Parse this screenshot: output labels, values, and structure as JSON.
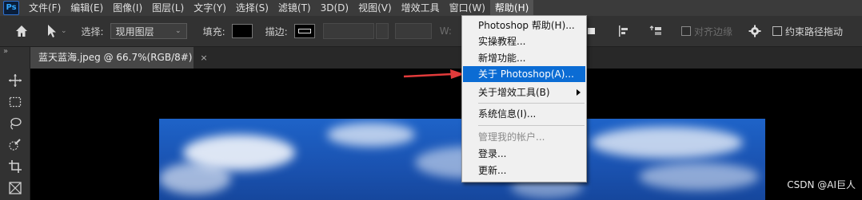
{
  "app": {
    "logo_text": "Ps"
  },
  "menubar": {
    "items": [
      "文件(F)",
      "编辑(E)",
      "图像(I)",
      "图层(L)",
      "文字(Y)",
      "选择(S)",
      "滤镜(T)",
      "3D(D)",
      "视图(V)",
      "增效工具",
      "窗口(W)",
      "帮助(H)"
    ],
    "active_index": 11
  },
  "options": {
    "select_label": "选择:",
    "select_value": "现用图层",
    "fill_label": "填充:",
    "stroke_label": "描边:",
    "w_label": "W:",
    "align_edges_label": "对齐边缘",
    "constrain_label": "约束路径拖动"
  },
  "document_tab": {
    "title": "蓝天蓝海.jpeg @ 66.7%(RGB/8#)",
    "close": "×"
  },
  "toolbar": {
    "collapse_glyph": "»"
  },
  "help_menu": {
    "items": [
      {
        "label": "Photoshop 帮助(H)...",
        "state": "normal"
      },
      {
        "label": "实操教程...",
        "state": "normal"
      },
      {
        "label": "新增功能...",
        "state": "normal"
      },
      {
        "label": "关于 Photoshop(A)...",
        "state": "highlighted"
      },
      {
        "label": "关于增效工具(B)",
        "state": "submenu"
      },
      {
        "label": "系统信息(I)...",
        "state": "normal"
      },
      {
        "label": "管理我的帐户...",
        "state": "disabled"
      },
      {
        "label": "登录...",
        "state": "normal"
      },
      {
        "label": "更新...",
        "state": "normal"
      }
    ]
  },
  "colors": {
    "highlight": "#0b6cd4",
    "annotation_arrow": "#e23b3b",
    "canvas_bg": "#000000",
    "sky": "#1a52b0"
  },
  "watermark": "CSDN @AI巨人"
}
